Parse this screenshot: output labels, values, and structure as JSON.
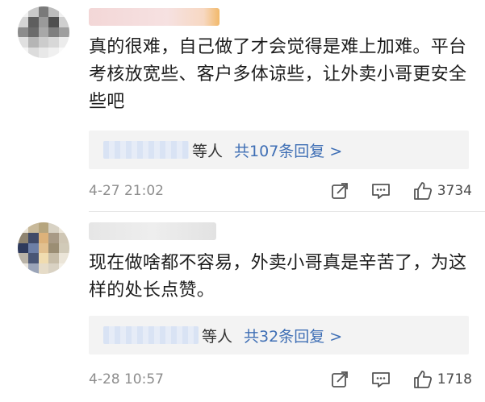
{
  "comments": [
    {
      "text": "真的很难，自己做了才会觉得是难上加难。平台考核放宽些、客户多体谅些，让外卖小哥更安全些吧",
      "reply_suffix": "等人",
      "reply_link": "共107条回复 >",
      "time": "4-27 21:02",
      "likes": "3734",
      "avatar_colors": [
        "#f2f2f2",
        "#c9c9c9",
        "#7a7a7a",
        "#bdbdbd",
        "#f0f0f0",
        "#d4d4d4",
        "#5e5e5e",
        "#9a9a9a",
        "#4f4f4f",
        "#cfcfcf",
        "#8c8c8c",
        "#6b6b6b",
        "#a8a8a8",
        "#7f7f7f",
        "#9e9e9e",
        "#e0e0e0",
        "#b5b5b5",
        "#cccccc",
        "#d8d8d8",
        "#ececec",
        "#f5f5f5",
        "#dcdcdc",
        "#e8e8e8",
        "#f0f0f0",
        "#fafafa"
      ]
    },
    {
      "text": "现在做啥都不容易，外卖小哥真是辛苦了，为这样的处长点赞。",
      "reply_suffix": "等人",
      "reply_link": "共32条回复 >",
      "time": "4-28 10:57",
      "likes": "1718",
      "avatar_colors": [
        "#e9e3d6",
        "#c8b99a",
        "#b6a57e",
        "#d8d2c4",
        "#ece6da",
        "#8f8470",
        "#404a68",
        "#ddb27a",
        "#a89a86",
        "#cfc6b4",
        "#2e3a5c",
        "#6d7fa6",
        "#e2c08f",
        "#9b8e74",
        "#d1cab8",
        "#b9b3a7",
        "#495675",
        "#f0dcb0",
        "#c7bda8",
        "#ebe5d8",
        "#ebe7df",
        "#9aa4b8",
        "#e6dcc8",
        "#d9d2c3",
        "#f3efe6"
      ]
    }
  ],
  "icons": {
    "share": "share-icon",
    "comment": "comment-icon",
    "like": "thumbs-up-icon"
  },
  "colors": {
    "link": "#3f6fb5",
    "meta": "#8e8e8e",
    "reply_bg": "#f3f3f3"
  }
}
